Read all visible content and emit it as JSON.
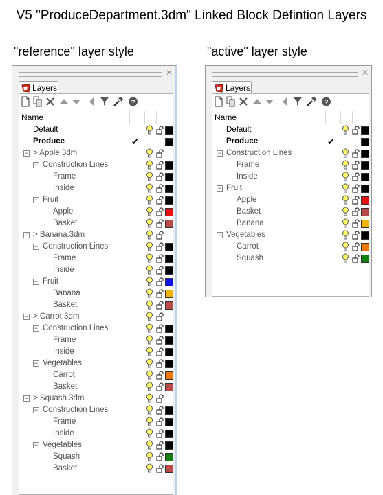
{
  "title": "V5 \"ProduceDepartment.3dm\" Linked Block Defintion Layers",
  "panels": [
    {
      "id": "panel-ref",
      "caption": "\"reference\" layer style",
      "tab": "Layers",
      "column_header": "Name",
      "rows": [
        {
          "label": "Default",
          "indent": 0,
          "expander": "",
          "bulb": true,
          "lock": true,
          "color": "#000000",
          "style": "black"
        },
        {
          "label": "Produce",
          "indent": 0,
          "expander": "",
          "bold": true,
          "check": true,
          "color": "#000000",
          "style": "black"
        },
        {
          "label": "> Apple.3dm",
          "indent": 0,
          "expander": "minus",
          "bulb": true,
          "lock": true,
          "color": null,
          "style": "gray"
        },
        {
          "label": "Construction Lines",
          "indent": 1,
          "expander": "minus",
          "bulb": true,
          "lock": true,
          "color": "#000000",
          "style": "gray"
        },
        {
          "label": "Frame",
          "indent": 2,
          "expander": "",
          "bulb": true,
          "lock": true,
          "color": "#000000",
          "style": "gray"
        },
        {
          "label": "Inside",
          "indent": 2,
          "expander": "",
          "bulb": true,
          "lock": true,
          "color": "#000000",
          "style": "gray"
        },
        {
          "label": "Fruit",
          "indent": 1,
          "expander": "minus",
          "bulb": true,
          "lock": true,
          "color": "#000000",
          "style": "gray"
        },
        {
          "label": "Apple",
          "indent": 2,
          "expander": "",
          "bulb": true,
          "lock": true,
          "color": "#e81010",
          "style": "gray"
        },
        {
          "label": "Basket",
          "indent": 2,
          "expander": "",
          "bulb": true,
          "lock": true,
          "color": "#b84a4a",
          "style": "gray"
        },
        {
          "label": "> Banana.3dm",
          "indent": 0,
          "expander": "minus",
          "bulb": true,
          "lock": true,
          "color": null,
          "style": "gray"
        },
        {
          "label": "Construction Lines",
          "indent": 1,
          "expander": "minus",
          "bulb": true,
          "lock": true,
          "color": "#000000",
          "style": "gray"
        },
        {
          "label": "Frame",
          "indent": 2,
          "expander": "",
          "bulb": true,
          "lock": true,
          "color": "#000000",
          "style": "gray"
        },
        {
          "label": "Inside",
          "indent": 2,
          "expander": "",
          "bulb": true,
          "lock": true,
          "color": "#000000",
          "style": "gray"
        },
        {
          "label": "Fruit",
          "indent": 1,
          "expander": "minus",
          "bulb": true,
          "lock": true,
          "color": "#1010e8",
          "style": "gray"
        },
        {
          "label": "Banana",
          "indent": 2,
          "expander": "",
          "bulb": true,
          "lock": true,
          "color": "#f0b400",
          "style": "gray"
        },
        {
          "label": "Basket",
          "indent": 2,
          "expander": "",
          "bulb": true,
          "lock": true,
          "color": "#b84a4a",
          "style": "gray"
        },
        {
          "label": "> Carrot.3dm",
          "indent": 0,
          "expander": "minus",
          "bulb": true,
          "lock": true,
          "color": null,
          "style": "gray"
        },
        {
          "label": "Construction Lines",
          "indent": 1,
          "expander": "minus",
          "bulb": true,
          "lock": true,
          "color": "#000000",
          "style": "gray"
        },
        {
          "label": "Frame",
          "indent": 2,
          "expander": "",
          "bulb": true,
          "lock": true,
          "color": "#000000",
          "style": "gray"
        },
        {
          "label": "Inside",
          "indent": 2,
          "expander": "",
          "bulb": true,
          "lock": true,
          "color": "#000000",
          "style": "gray"
        },
        {
          "label": "Vegetables",
          "indent": 1,
          "expander": "minus",
          "bulb": true,
          "lock": true,
          "color": "#000000",
          "style": "gray"
        },
        {
          "label": "Carrot",
          "indent": 2,
          "expander": "",
          "bulb": true,
          "lock": true,
          "color": "#f07800",
          "style": "gray"
        },
        {
          "label": "Basket",
          "indent": 2,
          "expander": "",
          "bulb": true,
          "lock": true,
          "color": "#b84a4a",
          "style": "gray"
        },
        {
          "label": "> Squash.3dm",
          "indent": 0,
          "expander": "minus",
          "bulb": true,
          "lock": true,
          "color": null,
          "style": "gray"
        },
        {
          "label": "Construction Lines",
          "indent": 1,
          "expander": "minus",
          "bulb": true,
          "lock": true,
          "color": "#000000",
          "style": "gray"
        },
        {
          "label": "Frame",
          "indent": 2,
          "expander": "",
          "bulb": true,
          "lock": true,
          "color": "#000000",
          "style": "gray"
        },
        {
          "label": "Inside",
          "indent": 2,
          "expander": "",
          "bulb": true,
          "lock": true,
          "color": "#000000",
          "style": "gray"
        },
        {
          "label": "Vegetables",
          "indent": 1,
          "expander": "minus",
          "bulb": true,
          "lock": true,
          "color": "#000000",
          "style": "gray"
        },
        {
          "label": "Squash",
          "indent": 2,
          "expander": "",
          "bulb": true,
          "lock": true,
          "color": "#108010",
          "style": "gray"
        },
        {
          "label": "Basket",
          "indent": 2,
          "expander": "",
          "bulb": true,
          "lock": true,
          "color": "#b84a4a",
          "style": "gray"
        }
      ]
    },
    {
      "id": "panel-act",
      "caption": "\"active\" layer style",
      "tab": "Layers",
      "column_header": "Name",
      "rows": [
        {
          "label": "Default",
          "indent": 0,
          "expander": "",
          "bulb": true,
          "lock": true,
          "color": "#000000",
          "style": "black"
        },
        {
          "label": "Produce",
          "indent": 0,
          "expander": "",
          "bold": true,
          "check": true,
          "color": "#000000",
          "style": "black"
        },
        {
          "label": "Construction Lines",
          "indent": 0,
          "expander": "minus",
          "bulb": true,
          "lock": true,
          "color": "#000000",
          "style": "gray"
        },
        {
          "label": "Frame",
          "indent": 1,
          "expander": "",
          "bulb": true,
          "lock": true,
          "color": "#000000",
          "style": "gray"
        },
        {
          "label": "Inside",
          "indent": 1,
          "expander": "",
          "bulb": true,
          "lock": true,
          "color": "#000000",
          "style": "gray"
        },
        {
          "label": "Fruit",
          "indent": 0,
          "expander": "minus",
          "bulb": true,
          "lock": true,
          "color": "#000000",
          "style": "gray"
        },
        {
          "label": "Apple",
          "indent": 1,
          "expander": "",
          "bulb": true,
          "lock": true,
          "color": "#e81010",
          "style": "gray"
        },
        {
          "label": "Basket",
          "indent": 1,
          "expander": "",
          "bulb": true,
          "lock": true,
          "color": "#b84a4a",
          "style": "gray"
        },
        {
          "label": "Banana",
          "indent": 1,
          "expander": "",
          "bulb": true,
          "lock": true,
          "color": "#f0b400",
          "style": "gray"
        },
        {
          "label": "Vegetables",
          "indent": 0,
          "expander": "minus",
          "bulb": true,
          "lock": true,
          "color": "#000000",
          "style": "gray"
        },
        {
          "label": "Carrot",
          "indent": 1,
          "expander": "",
          "bulb": true,
          "lock": true,
          "color": "#f07800",
          "style": "gray"
        },
        {
          "label": "Squash",
          "indent": 1,
          "expander": "",
          "bulb": true,
          "lock": true,
          "color": "#108010",
          "style": "gray"
        }
      ]
    }
  ],
  "toolbar_icons": [
    "new-layer-icon",
    "new-sublayer-icon",
    "delete-icon",
    "move-up-icon",
    "move-down-icon",
    "move-parent-icon",
    "filter-icon",
    "tools-icon",
    "help-icon"
  ]
}
